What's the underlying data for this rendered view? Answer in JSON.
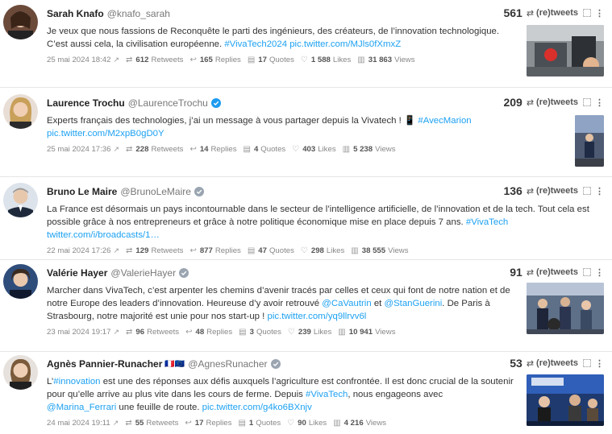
{
  "tweets": [
    {
      "name": "Sarah Knafo",
      "handle": "@knafo_sarah",
      "verified": false,
      "count": "561",
      "count_label": "(re)tweets",
      "text_parts": [
        {
          "t": "text",
          "v": "Je veux que nous fassions de Reconquête le parti des ingénieurs, des créateurs, de l’innovation technologique. C’est aussi cela, la civilisation européenne. "
        },
        {
          "t": "tag",
          "v": "#VivaTech2024"
        },
        {
          "t": "text",
          "v": " "
        },
        {
          "t": "link",
          "v": "pic.twitter.com/MJls0fXmxZ"
        }
      ],
      "date": "25 mai 2024 18:42",
      "retweets": "612",
      "retweets_label": "Retweets",
      "replies": "165",
      "replies_label": "Replies",
      "quotes": "17",
      "quotes_label": "Quotes",
      "likes": "1 588",
      "likes_label": "Likes",
      "views": "31 863",
      "views_label": "Views",
      "has_thumb": true
    },
    {
      "name": "Laurence Trochu",
      "handle": "@LaurenceTrochu",
      "verified": true,
      "count": "209",
      "count_label": "(re)tweets",
      "text_parts": [
        {
          "t": "text",
          "v": "Experts français des technologies, j’ai un message à vous partager depuis la Vivatech ! 📱 "
        },
        {
          "t": "tag",
          "v": "#AvecMarion"
        },
        {
          "t": "text",
          "v": " "
        },
        {
          "t": "link",
          "v": "pic.twitter.com/M2xpB0gD0Y"
        }
      ],
      "date": "25 mai 2024 17:36",
      "retweets": "228",
      "retweets_label": "Retweets",
      "replies": "14",
      "replies_label": "Replies",
      "quotes": "4",
      "quotes_label": "Quotes",
      "likes": "403",
      "likes_label": "Likes",
      "views": "5 238",
      "views_label": "Views",
      "has_thumb": true
    },
    {
      "name": "Bruno Le Maire",
      "handle": "@BrunoLeMaire",
      "verified": true,
      "count": "136",
      "count_label": "(re)tweets",
      "text_parts": [
        {
          "t": "text",
          "v": "La France est désormais un pays incontournable dans le secteur de l’intelligence artificielle, de l’innovation et de la tech. Tout cela est possible grâce à nos entrepreneurs et grâce à notre politique économique mise en place depuis 7 ans. "
        },
        {
          "t": "tag",
          "v": "#VivaTech"
        },
        {
          "t": "text",
          "v": " "
        },
        {
          "t": "link",
          "v": "twitter.com/i/broadcasts/1…"
        }
      ],
      "date": "22 mai 2024 17:26",
      "retweets": "129",
      "retweets_label": "Retweets",
      "replies": "877",
      "replies_label": "Replies",
      "quotes": "47",
      "quotes_label": "Quotes",
      "likes": "298",
      "likes_label": "Likes",
      "views": "38 555",
      "views_label": "Views",
      "has_thumb": false
    },
    {
      "name": "Valérie Hayer",
      "handle": "@ValerieHayer",
      "verified": true,
      "count": "91",
      "count_label": "(re)tweets",
      "text_parts": [
        {
          "t": "text",
          "v": "Marcher dans VivaTech, c’est arpenter les chemins d’avenir tracés par celles et ceux qui font de notre nation et de notre Europe des leaders d’innovation. Heureuse d’y avoir retrouvé "
        },
        {
          "t": "mention",
          "v": "@CaVautrin"
        },
        {
          "t": "text",
          "v": " et "
        },
        {
          "t": "mention",
          "v": "@StanGuerini"
        },
        {
          "t": "text",
          "v": ". De Paris à Strasbourg, notre majorité est unie pour nos start-up ! "
        },
        {
          "t": "link",
          "v": "pic.twitter.com/yq9llrvv6l"
        }
      ],
      "date": "23 mai 2024 19:17",
      "retweets": "96",
      "retweets_label": "Retweets",
      "replies": "48",
      "replies_label": "Replies",
      "quotes": "3",
      "quotes_label": "Quotes",
      "likes": "239",
      "likes_label": "Likes",
      "views": "10 941",
      "views_label": "Views",
      "has_thumb": true
    },
    {
      "name": "Agnès Pannier-Runacher",
      "flags": "🇫🇷🇪🇺",
      "handle": "@AgnesRunacher",
      "verified": true,
      "count": "53",
      "count_label": "(re)tweets",
      "text_parts": [
        {
          "t": "text",
          "v": "L’"
        },
        {
          "t": "tag",
          "v": "#innovation"
        },
        {
          "t": "text",
          "v": " est une des réponses aux défis auxquels l’agriculture est confrontée. Il est donc crucial de la soutenir pour qu’elle arrive au plus vite dans les cours de ferme. Depuis "
        },
        {
          "t": "tag",
          "v": "#VivaTech"
        },
        {
          "t": "text",
          "v": ", nous engageons avec "
        },
        {
          "t": "mention",
          "v": "@Marina_Ferrari"
        },
        {
          "t": "text",
          "v": " une feuille de route. "
        },
        {
          "t": "link",
          "v": "pic.twitter.com/g4ko6BXnjv"
        }
      ],
      "date": "24 mai 2024 19:11",
      "retweets": "55",
      "retweets_label": "Retweets",
      "replies": "17",
      "replies_label": "Replies",
      "quotes": "1",
      "quotes_label": "Quotes",
      "likes": "90",
      "likes_label": "Likes",
      "views": "4 216",
      "views_label": "Views",
      "has_thumb": true
    }
  ],
  "icons": {
    "external": "external-link-icon",
    "retweet": "retweet-icon",
    "reply": "reply-icon",
    "quote": "quote-icon",
    "like": "heart-icon",
    "views": "bar-chart-icon",
    "expand": "expand-icon",
    "more": "more-vertical-icon"
  },
  "colors": {
    "link": "#1da1f2",
    "verified": "#1d9bf0",
    "divider": "#e6e6e6"
  }
}
